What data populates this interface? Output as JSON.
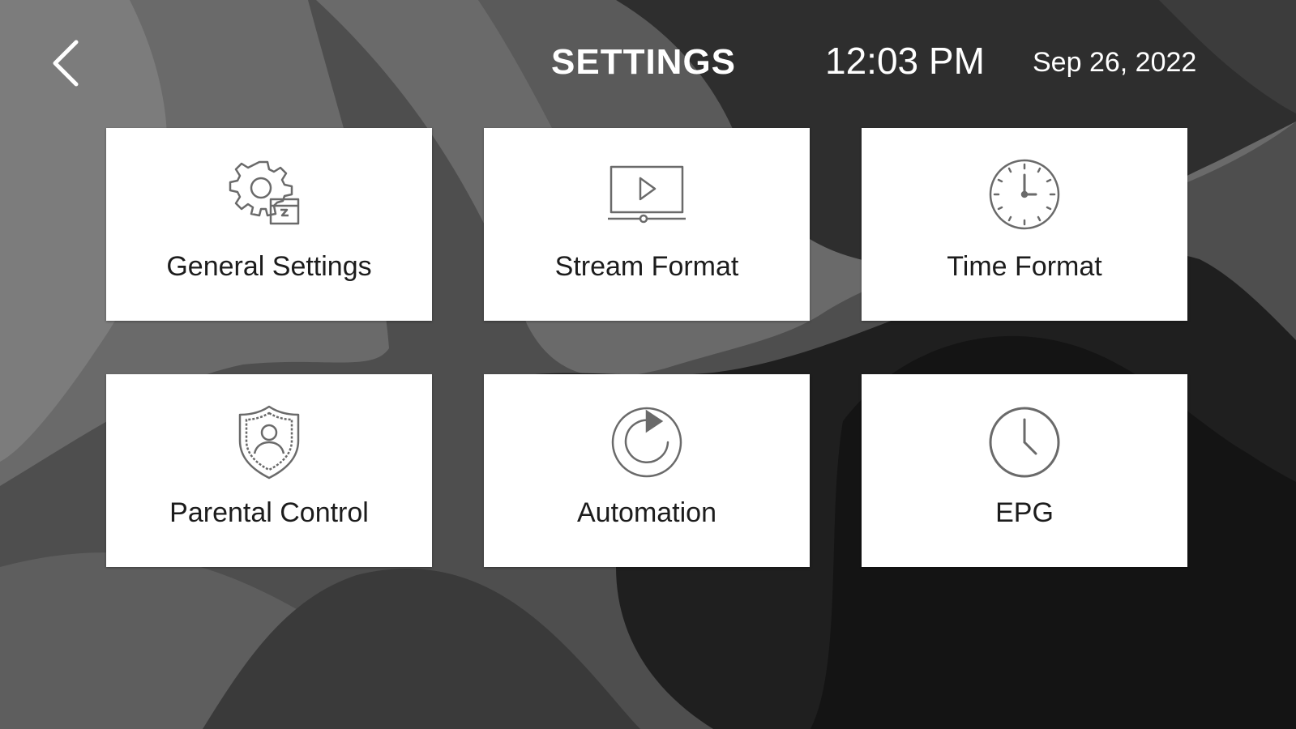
{
  "header": {
    "title": "SETTINGS",
    "time": "12:03 PM",
    "date": "Sep 26, 2022",
    "back_icon": "chevron-left-icon"
  },
  "tiles": [
    {
      "label": "General Settings",
      "icon": "gear-icon"
    },
    {
      "label": "Stream Format",
      "icon": "video-play-icon"
    },
    {
      "label": "Time Format",
      "icon": "clock-dial-icon"
    },
    {
      "label": "Parental Control",
      "icon": "shield-user-icon"
    },
    {
      "label": "Automation",
      "icon": "refresh-icon"
    },
    {
      "label": "EPG",
      "icon": "clock-icon"
    }
  ],
  "colors": {
    "tile_background": "#ffffff",
    "text_light": "#ffffff",
    "text_dark": "#1c1c1c",
    "icon_stroke": "#6a6a6a"
  }
}
